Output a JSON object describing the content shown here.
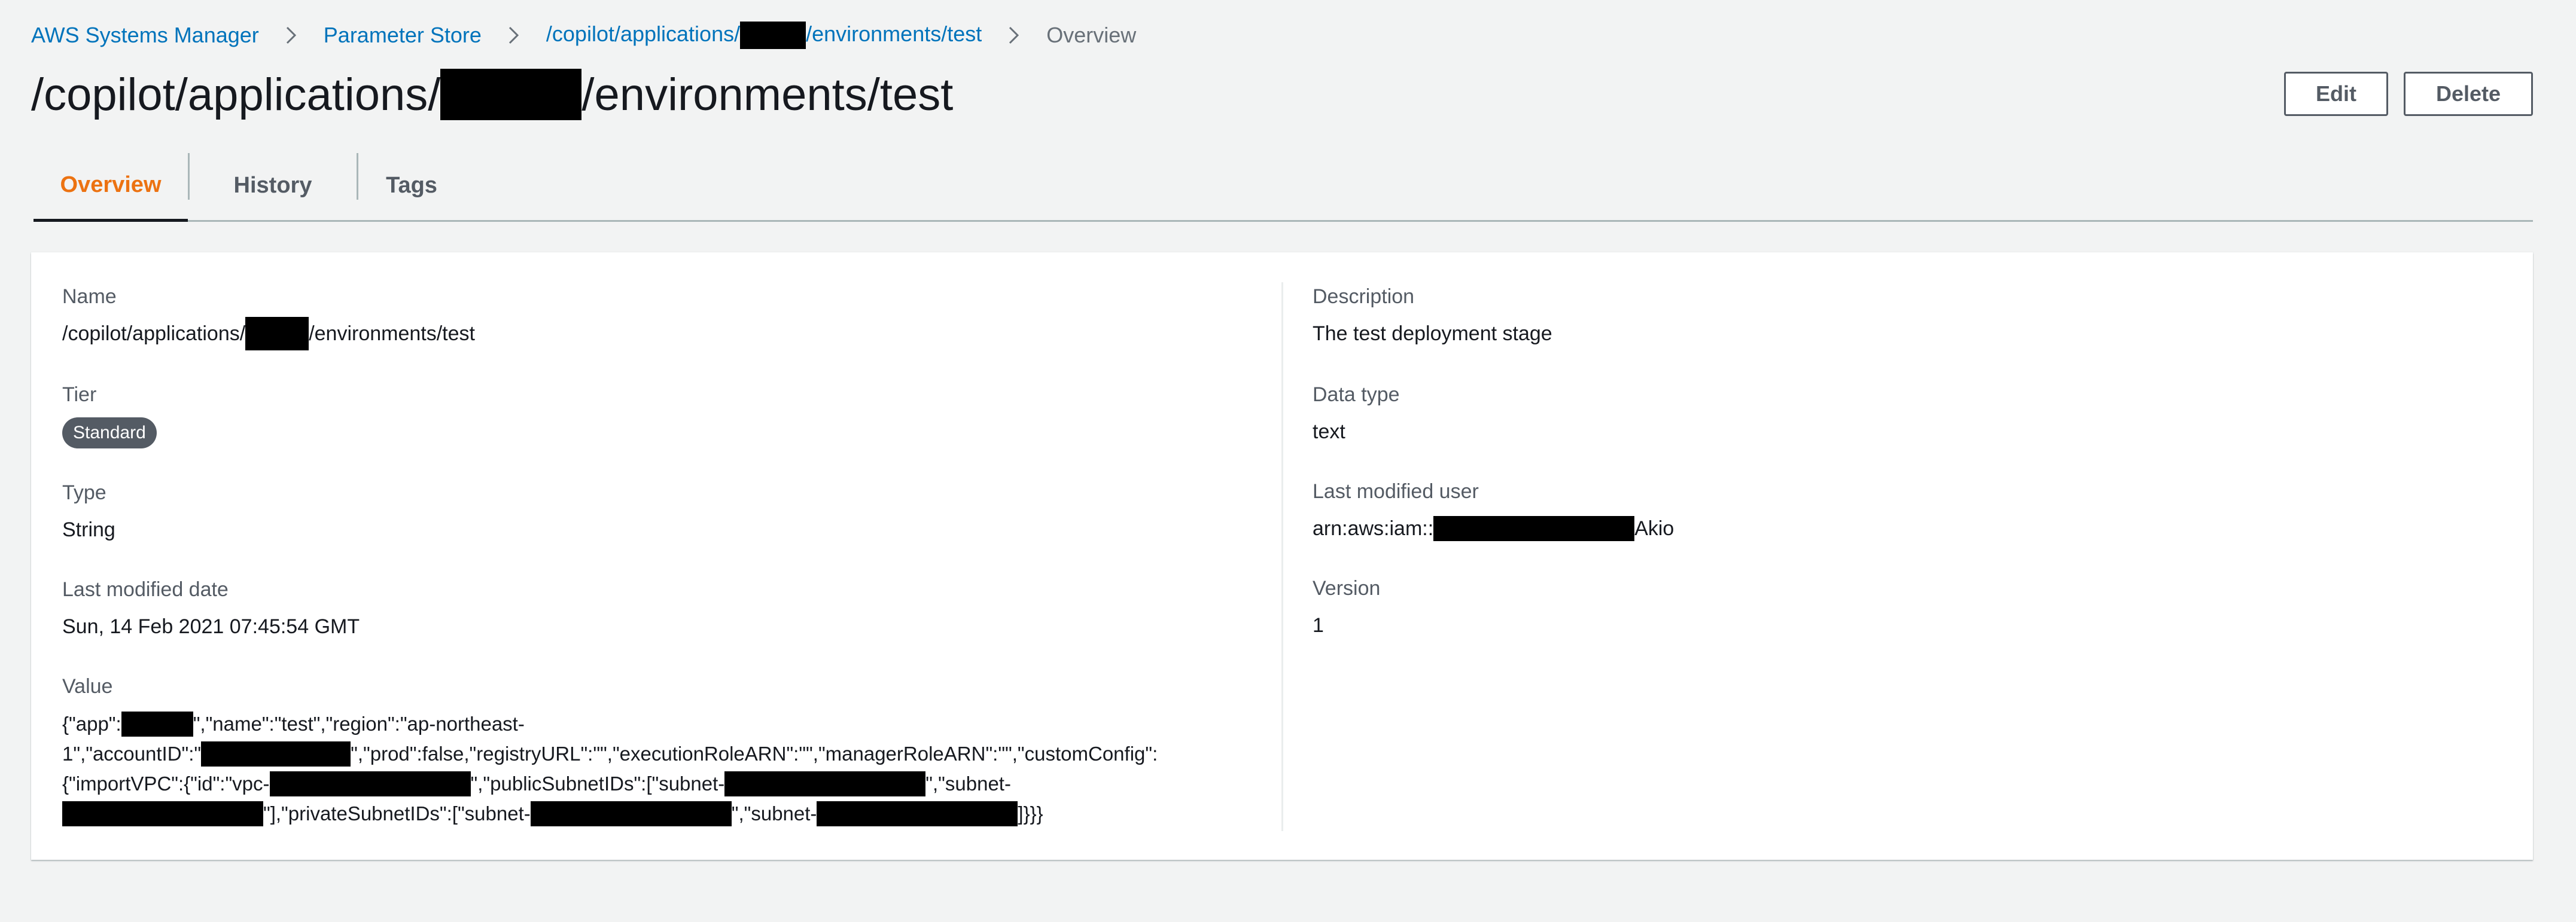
{
  "breadcrumb": {
    "items": [
      "AWS Systems Manager",
      "Parameter Store",
      "/copilot/applications/",
      "/environments/test"
    ],
    "current": "Overview"
  },
  "title": {
    "prefix": "/copilot/applications/",
    "suffix": "/environments/test"
  },
  "actions": {
    "edit_label": "Edit",
    "delete_label": "Delete"
  },
  "tabs": [
    {
      "label": "Overview",
      "active": true
    },
    {
      "label": "History",
      "active": false
    },
    {
      "label": "Tags",
      "active": false
    }
  ],
  "details": {
    "name": {
      "label": "Name",
      "value_prefix": "/copilot/applications/",
      "value_suffix": "/environments/test"
    },
    "tier": {
      "label": "Tier",
      "value": "Standard"
    },
    "type": {
      "label": "Type",
      "value": "String"
    },
    "last_modified_date": {
      "label": "Last modified date",
      "value": "Sun, 14 Feb 2021 07:45:54 GMT"
    },
    "value": {
      "label": "Value",
      "line1_a": "{\"app\":",
      "line1_b": "\",\"name\":\"test\",\"region\":\"ap-northeast-",
      "line2_a": "1\",\"accountID\":\"",
      "line2_b": "\",\"prod\":false,\"registryURL\":\"\",\"executionRoleARN\":\"\",\"managerRoleARN\":\"\",\"customConfig\":",
      "line3_a": "{\"importVPC\":{\"id\":\"vpc-",
      "line3_b": "\",\"publicSubnetIDs\":[\"subnet-",
      "line3_c": "\",\"subnet-",
      "line4_a": "\"],\"privateSubnetIDs\":[\"subnet-",
      "line4_b": "\",\"subnet-",
      "line4_c": "]}}}"
    },
    "description": {
      "label": "Description",
      "value": "The test deployment stage"
    },
    "data_type": {
      "label": "Data type",
      "value": "text"
    },
    "last_modified_user": {
      "label": "Last modified user",
      "value_prefix": "arn:aws:iam::",
      "value_suffix": "Akio"
    },
    "version": {
      "label": "Version",
      "value": "1"
    }
  },
  "colors": {
    "link": "#0073bb",
    "active_tab": "#ec7211",
    "background": "#f2f3f3",
    "badge": "#545b64"
  }
}
